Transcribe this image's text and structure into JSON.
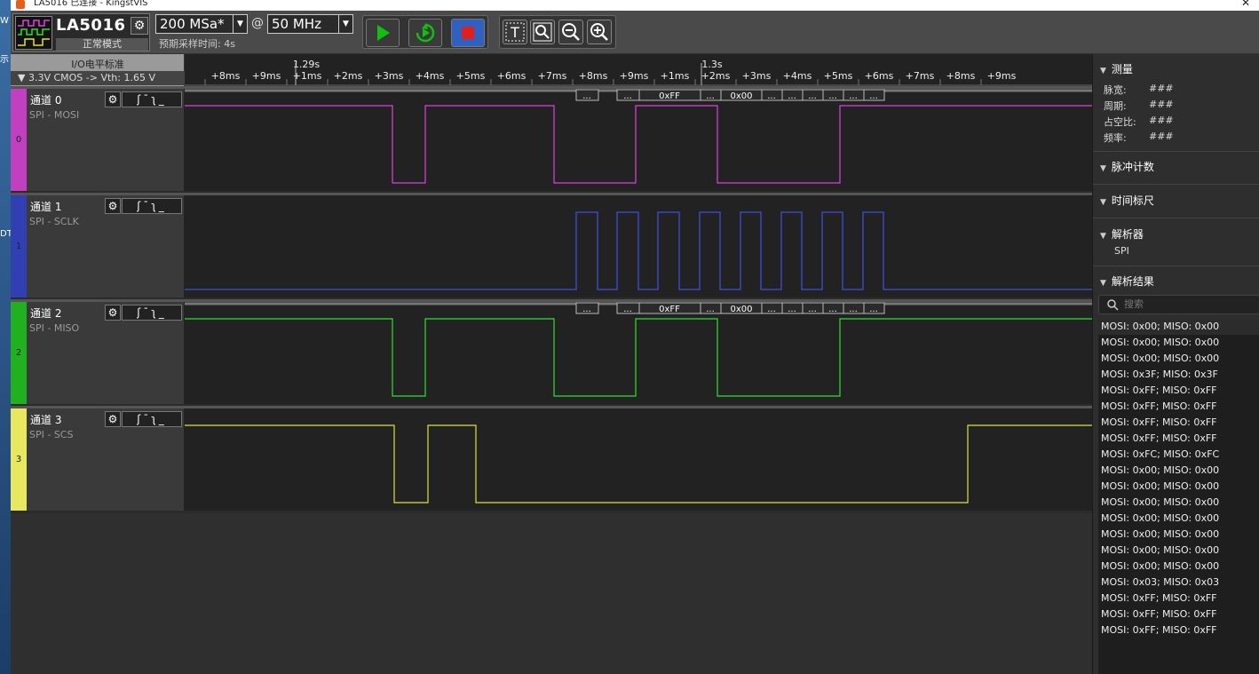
{
  "window": {
    "title": "LA5016 已连接 - KingstVIS"
  },
  "desktop_fragments": [
    "W",
    "示",
    "DT"
  ],
  "toolbar": {
    "device_name": "LA5016",
    "device_mode": "正常模式",
    "sample_rate": "200 MSa*",
    "at_sign": "@",
    "sample_depth": "50 MHz",
    "est_time": "预期采样时间: 4s",
    "text_tool_label": "T"
  },
  "io": {
    "title": "I/O电平标准",
    "value": "▼  3.3V CMOS  -> Vth: 1.65 V"
  },
  "ruler": {
    "ticks": [
      "+8ms",
      "+9ms",
      "+1ms",
      "+2ms",
      "+3ms",
      "+4ms",
      "+5ms",
      "+6ms",
      "+7ms",
      "+8ms",
      "+9ms",
      "+1ms",
      "+2ms",
      "+3ms",
      "+4ms",
      "+5ms",
      "+6ms",
      "+7ms",
      "+8ms",
      "+9ms"
    ],
    "major": [
      "1.29s",
      "1.3s"
    ]
  },
  "channels": [
    {
      "name": "通道 0",
      "proto": "SPI - MOSI",
      "num": "0",
      "color": "#c040c0",
      "wave": "#e040e0",
      "trig": "ʃ¯ʅ_",
      "gear": "⚙"
    },
    {
      "name": "通道 1",
      "proto": "SPI - SCLK",
      "num": "1",
      "color": "#3040b0",
      "wave": "#4050e0",
      "trig": "ʃ¯ʅ_",
      "gear": "⚙"
    },
    {
      "name": "通道 2",
      "proto": "SPI - MISO",
      "num": "2",
      "color": "#20b020",
      "wave": "#30e030",
      "trig": "ʃ¯ʅ_",
      "gear": "⚙"
    },
    {
      "name": "通道 3",
      "proto": "SPI - SCS",
      "num": "3",
      "color": "#e8e860",
      "wave": "#e0e040",
      "trig": "ʃ¯ʅ_",
      "gear": "⚙"
    }
  ],
  "decode_labels": [
    "...",
    "...",
    "0xFF",
    "...",
    "0x00",
    "...",
    "...",
    "...",
    "...",
    "...",
    "..."
  ],
  "right_panel": {
    "measure_title": "测量",
    "measures": [
      {
        "label": "脉宽:",
        "value": "###"
      },
      {
        "label": "周期:",
        "value": "###"
      },
      {
        "label": "占空比:",
        "value": "###"
      },
      {
        "label": "频率:",
        "value": "###"
      }
    ],
    "pulse_count_title": "脉冲计数",
    "time_ruler_title": "时间标尺",
    "analyzer_title": "解析器",
    "analyzer_item": "SPI",
    "results_title": "解析结果",
    "search_placeholder": "搜索",
    "results": [
      "MOSI: 0x00;  MISO: 0x00",
      "MOSI: 0x00;  MISO: 0x00",
      "MOSI: 0x00;  MISO: 0x00",
      "MOSI: 0x3F;  MISO: 0x3F",
      "MOSI: 0xFF;  MISO: 0xFF",
      "MOSI: 0xFF;  MISO: 0xFF",
      "MOSI: 0xFF;  MISO: 0xFF",
      "MOSI: 0xFF;  MISO: 0xFF",
      "MOSI: 0xFC;  MISO: 0xFC",
      "MOSI: 0x00;  MISO: 0x00",
      "MOSI: 0x00;  MISO: 0x00",
      "MOSI: 0x00;  MISO: 0x00",
      "MOSI: 0x00;  MISO: 0x00",
      "MOSI: 0x00;  MISO: 0x00",
      "MOSI: 0x00;  MISO: 0x00",
      "MOSI: 0x00;  MISO: 0x00",
      "MOSI: 0x03;  MISO: 0x03",
      "MOSI: 0xFF;  MISO: 0xFF",
      "MOSI: 0xFF;  MISO: 0xFF",
      "MOSI: 0xFF;  MISO: 0xFF"
    ]
  },
  "colors": {
    "play": "#10c010",
    "loop": "#10c010",
    "stop": "#e02020",
    "stop_bg": "#3060c0"
  }
}
